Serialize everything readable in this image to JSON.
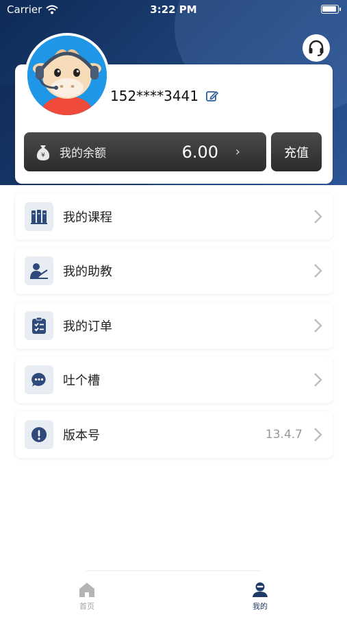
{
  "status_bar": {
    "carrier": "Carrier",
    "time": "3:22 PM"
  },
  "profile": {
    "phone": "152****3441"
  },
  "balance": {
    "label": "我的余额",
    "amount": "6.00",
    "arrow": "›"
  },
  "recharge_label": "充值",
  "menu": [
    {
      "label": "我的课程",
      "icon": "books-icon"
    },
    {
      "label": "我的助教",
      "icon": "teacher-icon"
    },
    {
      "label": "我的订单",
      "icon": "order-icon"
    },
    {
      "label": "吐个槽",
      "icon": "chat-bubble-icon"
    },
    {
      "label": "版本号",
      "icon": "info-icon",
      "value": "13.4.7"
    }
  ],
  "tabbar": {
    "home_label": "首页",
    "mine_label": "我的",
    "active": "mine",
    "active_color": "#203a68",
    "inactive_color": "#a5a5a5"
  },
  "colors": {
    "header": "#1c3f74",
    "icon_accent": "#2e4a7a",
    "icon_bg": "#e8edf3"
  }
}
